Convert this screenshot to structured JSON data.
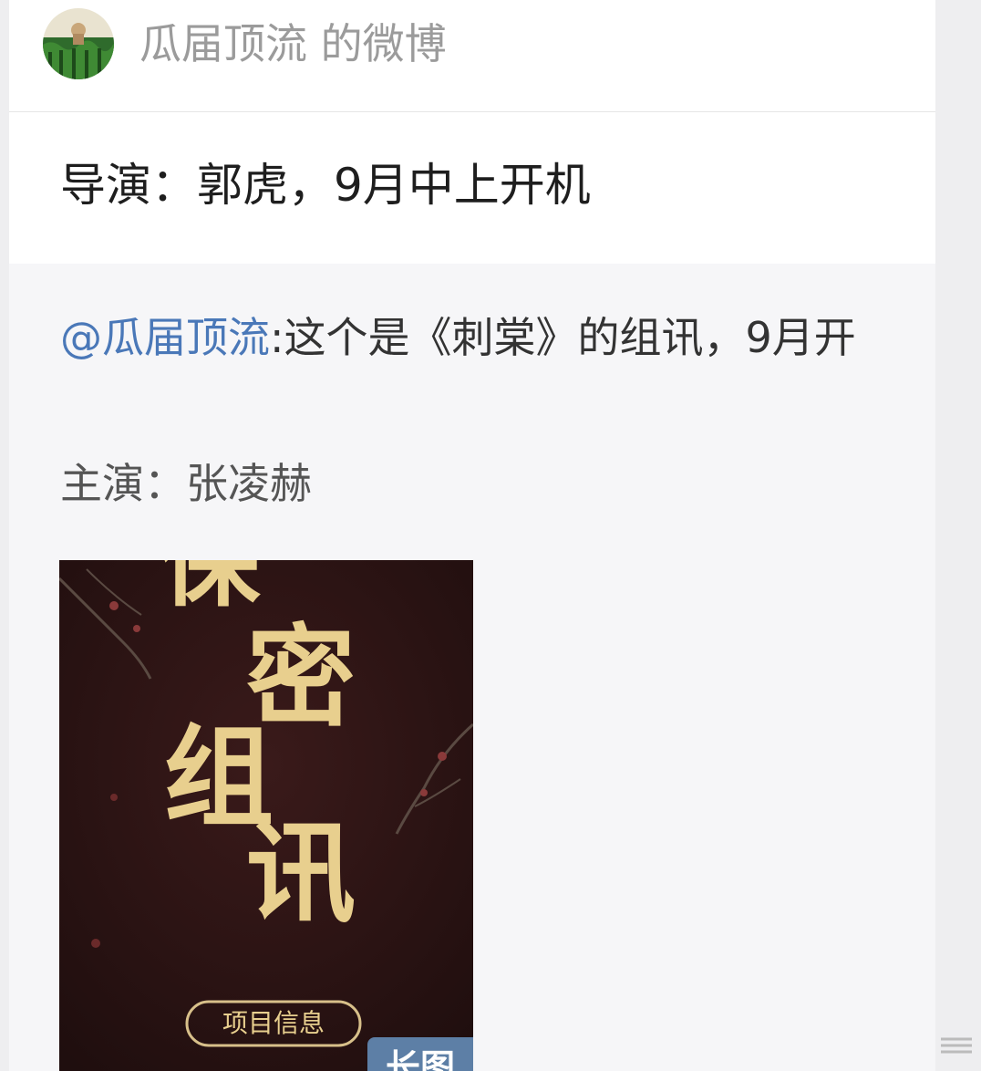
{
  "header": {
    "avatar_icon": "watermelon-avatar-icon",
    "title": "瓜届顶流 的微博"
  },
  "post": {
    "text": "导演：郭虎，9月中上开机"
  },
  "repost": {
    "mention": "@瓜届顶流",
    "body": ":这个是《刺棠》的组讯，9月开",
    "cast": "主演：张凌赫"
  },
  "image": {
    "poster_text": "保密组讯",
    "poster_button": "项目信息",
    "badge": "长图"
  },
  "colors": {
    "link": "#4a78b8",
    "badge_bg": "#5d7fa6",
    "poster_bg": "#2a1414",
    "poster_gold": "#e8cf8e"
  }
}
